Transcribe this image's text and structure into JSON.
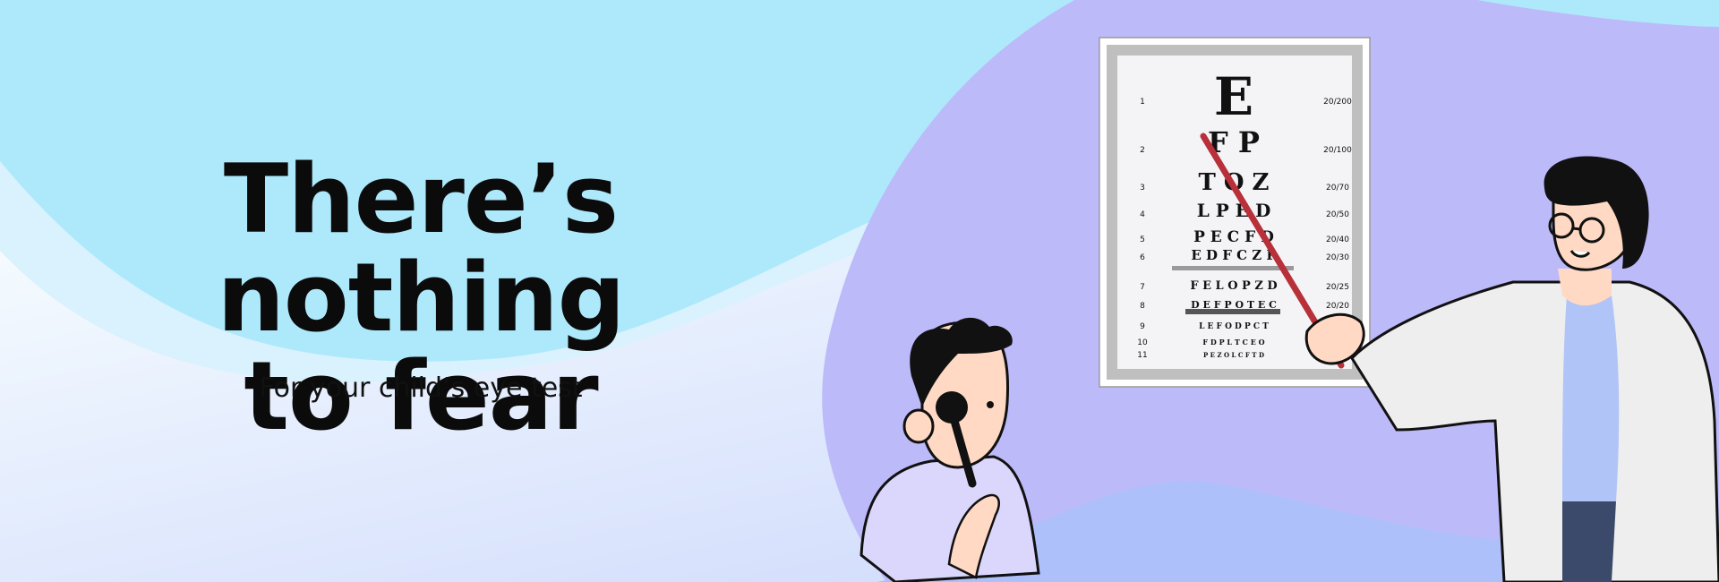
{
  "hero": {
    "headline_line1": "There’s nothing",
    "headline_line2": "to fear",
    "subheadline": "For your child’s eye test"
  },
  "eye_chart": {
    "rows": [
      {
        "num": "1",
        "letters": "E",
        "acuity": "20/200"
      },
      {
        "num": "2",
        "letters": "F  P",
        "acuity": "20/100"
      },
      {
        "num": "3",
        "letters": "T O Z",
        "acuity": "20/70"
      },
      {
        "num": "4",
        "letters": "L P E D",
        "acuity": "20/50"
      },
      {
        "num": "5",
        "letters": "P E C F D",
        "acuity": "20/40"
      },
      {
        "num": "6",
        "letters": "E D F C Z P",
        "acuity": "20/30"
      },
      {
        "num": "7",
        "letters": "F E L O P Z D",
        "acuity": "20/25"
      },
      {
        "num": "8",
        "letters": "D E F P O T E C",
        "acuity": "20/20"
      },
      {
        "num": "9",
        "letters": "L E F O D P C T",
        "acuity": ""
      },
      {
        "num": "10",
        "letters": "F D P L T C E O",
        "acuity": ""
      },
      {
        "num": "11",
        "letters": "P E Z O L C F T D",
        "acuity": ""
      }
    ]
  },
  "colors": {
    "sky": "#ade9fb",
    "lavender": "#bdbaf9",
    "wave_light": "#e9f6fd",
    "pointer": "#b7303a"
  }
}
